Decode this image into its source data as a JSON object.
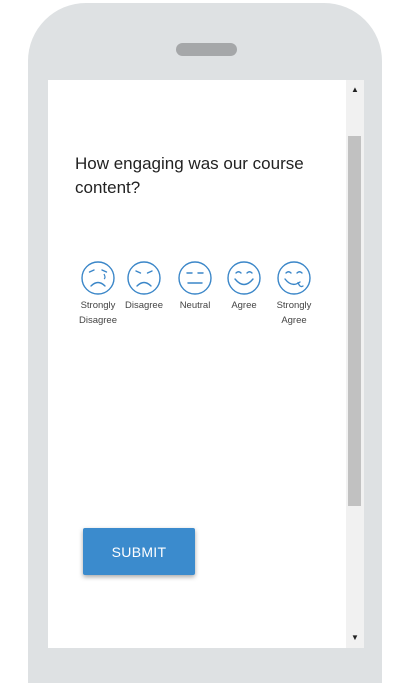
{
  "survey": {
    "question": "How engaging was our course content?",
    "options": [
      {
        "label": "Strongly\nDisagree",
        "icon": "very-sad-face-icon"
      },
      {
        "label": "Disagree",
        "icon": "sad-face-icon"
      },
      {
        "label": "Neutral",
        "icon": "neutral-face-icon"
      },
      {
        "label": "Agree",
        "icon": "smile-face-icon"
      },
      {
        "label": "Strongly\nAgree",
        "icon": "big-smile-face-icon"
      }
    ],
    "submit_label": "SUBMIT"
  },
  "scrollbar": {
    "up_glyph": "▲",
    "down_glyph": "▼"
  },
  "colors": {
    "accent": "#3b8bcd",
    "face_stroke": "#3a86c8",
    "device_frame": "#dee1e3"
  }
}
